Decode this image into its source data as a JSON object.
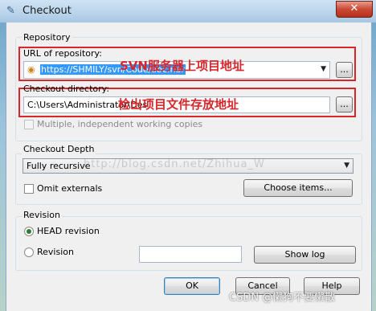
{
  "window": {
    "title": "Checkout",
    "close_glyph": "✕"
  },
  "repository": {
    "group_label": "Repository",
    "url_label": "URL of repository:",
    "url_value": "https://SHMILY/svn/Code/abc.nar",
    "url_annotation": "SVN服务器上项目地址",
    "dir_label": "Checkout directory:",
    "dir_value": "C:\\Users\\Administrator\\Desktop\\abc",
    "dir_annotation": "检出项目文件存放地址",
    "browse_label": "...",
    "multiple_label": "Multiple, independent working copies"
  },
  "depth": {
    "group_label": "Checkout Depth",
    "depth_value": "Fully recursive",
    "omit_externals_label": "Omit externals",
    "choose_items_label": "Choose items..."
  },
  "revision": {
    "group_label": "Revision",
    "head_label": "HEAD revision",
    "revision_label": "Revision",
    "revision_value": "",
    "show_log_label": "Show log"
  },
  "footer": {
    "ok_label": "OK",
    "cancel_label": "Cancel",
    "help_label": "Help"
  },
  "overlay": {
    "url_watermark": "http://blog.csdn.net/Zhihua_W",
    "csdn_watermark": "CSDN @懒狗不要懒散"
  },
  "colors": {
    "annotation": "#d8262a",
    "selection": "#3399ff"
  }
}
